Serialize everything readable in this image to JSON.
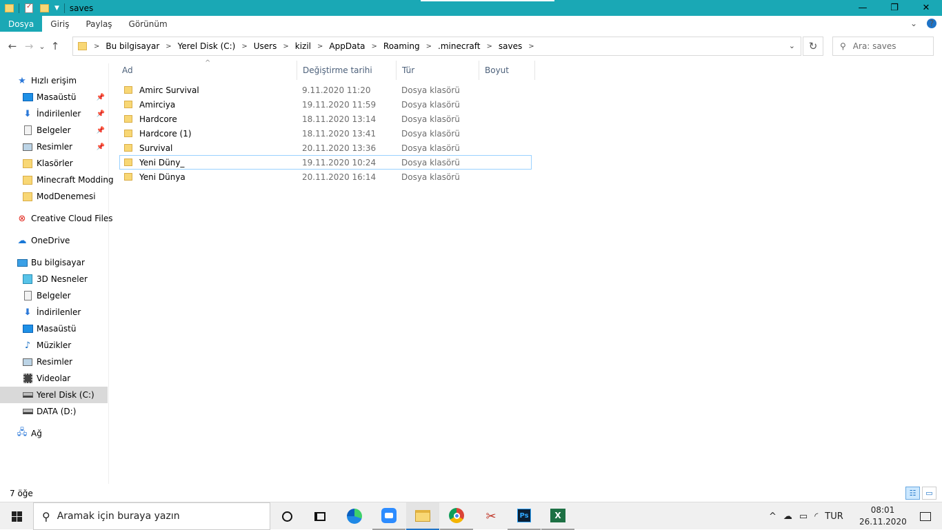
{
  "window": {
    "title": "saves",
    "controls": {
      "minimize": "—",
      "maximize": "❐",
      "close": "✕"
    }
  },
  "ribbon": {
    "tabs": [
      {
        "label": "Dosya",
        "active": true
      },
      {
        "label": "Giriş",
        "active": false
      },
      {
        "label": "Paylaş",
        "active": false
      },
      {
        "label": "Görünüm",
        "active": false
      }
    ],
    "expand_icon": "chevron-down-icon",
    "help_icon": "?"
  },
  "navigation": {
    "back_icon": "←",
    "forward_icon": "→",
    "recent_icon": "⌄",
    "up_icon": "↑"
  },
  "address": {
    "breadcrumbs": [
      "Bu bilgisayar",
      "Yerel Disk (C:)",
      "Users",
      "kizil",
      "AppData",
      "Roaming",
      ".minecraft",
      "saves"
    ]
  },
  "search": {
    "placeholder": "Ara: saves"
  },
  "sidebar": {
    "quick_access": {
      "label": "Hızlı erişim",
      "items": [
        {
          "label": "Masaüstü",
          "icon": "desktop-icon",
          "pinned": true
        },
        {
          "label": "İndirilenler",
          "icon": "downloads-icon",
          "pinned": true
        },
        {
          "label": "Belgeler",
          "icon": "documents-icon",
          "pinned": true
        },
        {
          "label": "Resimler",
          "icon": "pictures-icon",
          "pinned": true
        },
        {
          "label": "Klasörler",
          "icon": "folder-icon",
          "pinned": false
        },
        {
          "label": "Minecraft Modding",
          "icon": "folder-icon",
          "pinned": false
        },
        {
          "label": "ModDenemesi",
          "icon": "folder-icon",
          "pinned": false
        }
      ]
    },
    "creative_cloud": {
      "label": "Creative Cloud Files"
    },
    "onedrive": {
      "label": "OneDrive"
    },
    "this_pc": {
      "label": "Bu bilgisayar",
      "items": [
        {
          "label": "3D Nesneler",
          "icon": "3d-objects-icon"
        },
        {
          "label": "Belgeler",
          "icon": "documents-icon"
        },
        {
          "label": "İndirilenler",
          "icon": "downloads-icon"
        },
        {
          "label": "Masaüstü",
          "icon": "desktop-icon"
        },
        {
          "label": "Müzikler",
          "icon": "music-icon"
        },
        {
          "label": "Resimler",
          "icon": "pictures-icon"
        },
        {
          "label": "Videolar",
          "icon": "videos-icon"
        },
        {
          "label": "Yerel Disk (C:)",
          "icon": "local-disk-icon",
          "selected": true
        },
        {
          "label": "DATA (D:)",
          "icon": "drive-icon"
        }
      ]
    },
    "network": {
      "label": "Ağ"
    }
  },
  "file_list": {
    "columns": [
      "Ad",
      "Değiştirme tarihi",
      "Tür",
      "Boyut"
    ],
    "sort_indicator": "^",
    "rows": [
      {
        "name": "Amirc Survival",
        "modified": "9.11.2020 11:20",
        "type": "Dosya klasörü",
        "size": ""
      },
      {
        "name": "Amirciya",
        "modified": "19.11.2020 11:59",
        "type": "Dosya klasörü",
        "size": ""
      },
      {
        "name": "Hardcore",
        "modified": "18.11.2020 13:14",
        "type": "Dosya klasörü",
        "size": ""
      },
      {
        "name": "Hardcore (1)",
        "modified": "18.11.2020 13:41",
        "type": "Dosya klasörü",
        "size": ""
      },
      {
        "name": "Survival",
        "modified": "20.11.2020 13:36",
        "type": "Dosya klasörü",
        "size": ""
      },
      {
        "name": "Yeni Düny_",
        "modified": "19.11.2020 10:24",
        "type": "Dosya klasörü",
        "size": "",
        "focused": true
      },
      {
        "name": "Yeni Dünya",
        "modified": "20.11.2020 16:14",
        "type": "Dosya klasörü",
        "size": ""
      }
    ]
  },
  "status_bar": {
    "item_count": "7 öğe"
  },
  "taskbar": {
    "search_placeholder": "Aramak için buraya yazın",
    "apps": [
      "cortana",
      "task-view",
      "edge",
      "zoom",
      "file-explorer",
      "chrome",
      "snipping-tool",
      "photoshop",
      "excel"
    ],
    "tray": {
      "language": "TUR",
      "time": "08:01",
      "date": "26.11.2020"
    }
  },
  "colors": {
    "title_accent": "#1aa8b5",
    "selection": "#d9d9d9",
    "focus_border": "#99d1ff",
    "folder": "#f8d775"
  }
}
